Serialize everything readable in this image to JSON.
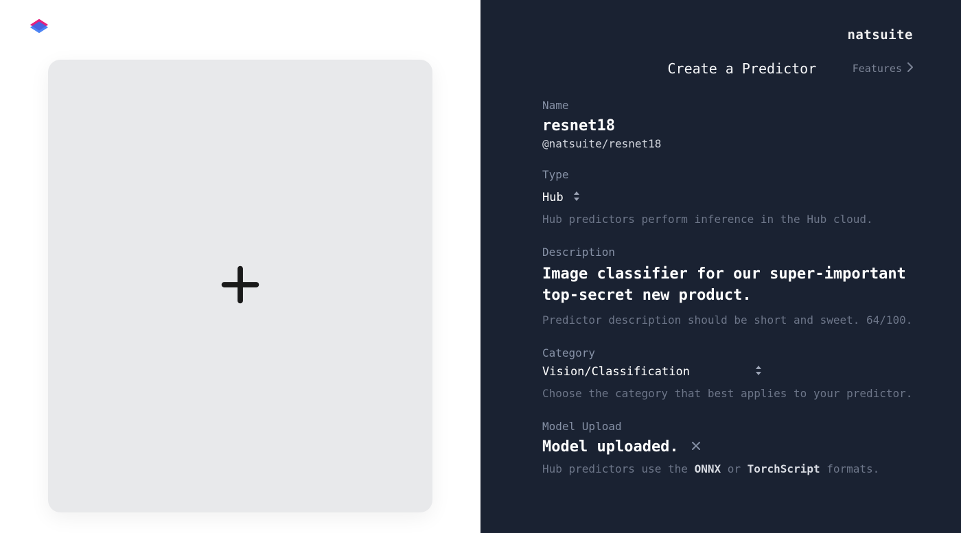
{
  "brand": "natsuite",
  "header": {
    "title": "Create a Predictor",
    "features_label": "Features"
  },
  "left": {
    "upload_icon": "plus-icon"
  },
  "form": {
    "name": {
      "label": "Name",
      "value": "resnet18",
      "path": "@natsuite/resnet18"
    },
    "type": {
      "label": "Type",
      "value": "Hub",
      "helper": "Hub predictors perform inference in the Hub cloud."
    },
    "description": {
      "label": "Description",
      "value": "Image classifier for our super-important top-secret new product.",
      "helper": "Predictor description should be short and sweet. 64/100."
    },
    "category": {
      "label": "Category",
      "value": "Vision/Classification",
      "helper": "Choose the category that best applies to your predictor."
    },
    "model_upload": {
      "label": "Model Upload",
      "status": "Model uploaded.",
      "helper_prefix": "Hub predictors use the ",
      "format1": "ONNX",
      "helper_mid": " or ",
      "format2": "TorchScript",
      "helper_suffix": " formats."
    }
  }
}
